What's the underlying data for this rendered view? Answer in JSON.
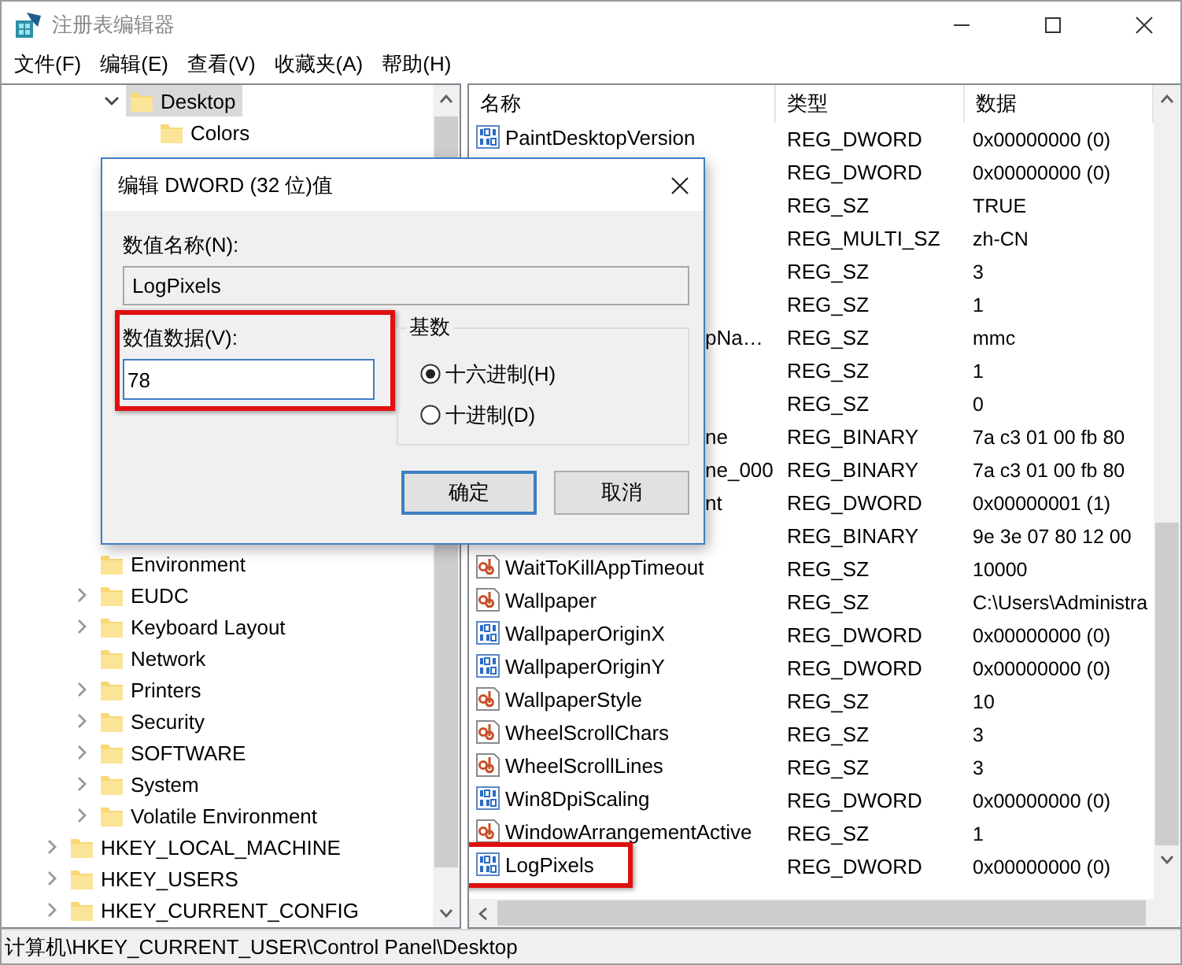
{
  "window": {
    "title": "注册表编辑器"
  },
  "menu": [
    "文件(F)",
    "编辑(E)",
    "查看(V)",
    "收藏夹(A)",
    "帮助(H)"
  ],
  "tree": {
    "items": [
      {
        "children": [
          {
            "children": [
              {
                "label": "Desktop",
                "expandable": true,
                "expanded": true,
                "selected": true,
                "children": [
                  {
                    "label": "Colors",
                    "expandable": false,
                    "selected": false
                  }
                ]
              }
            ]
          },
          {
            "label": "Environment",
            "expandable": false,
            "selected": false
          },
          {
            "label": "EUDC",
            "expandable": true,
            "expanded": false,
            "selected": false
          },
          {
            "label": "Keyboard Layout",
            "expandable": true,
            "expanded": false,
            "selected": false
          },
          {
            "label": "Network",
            "expandable": false,
            "selected": false
          },
          {
            "label": "Printers",
            "expandable": true,
            "expanded": false,
            "selected": false
          },
          {
            "label": "Security",
            "expandable": true,
            "expanded": false,
            "selected": false
          },
          {
            "label": "SOFTWARE",
            "expandable": true,
            "expanded": false,
            "selected": false
          },
          {
            "label": "System",
            "expandable": true,
            "expanded": false,
            "selected": false
          },
          {
            "label": "Volatile Environment",
            "expandable": true,
            "expanded": false,
            "selected": false
          }
        ]
      },
      {
        "label": "HKEY_LOCAL_MACHINE",
        "expandable": true,
        "expanded": false,
        "selected": false
      },
      {
        "label": "HKEY_USERS",
        "expandable": true,
        "expanded": false,
        "selected": false
      },
      {
        "label": "HKEY_CURRENT_CONFIG",
        "expandable": true,
        "expanded": false,
        "selected": false
      }
    ]
  },
  "table": {
    "columns": [
      "名称",
      "类型",
      "数据"
    ],
    "rows": [
      {
        "kind": "dword",
        "name": "PaintDesktopVersion",
        "type": "REG_DWORD",
        "data": "0x00000000 (0)",
        "covered": false,
        "annotated": false
      },
      {
        "type": "REG_DWORD",
        "data": "0x00000000 (0)",
        "annotated": false
      },
      {
        "type": "REG_SZ",
        "data": "TRUE",
        "annotated": false
      },
      {
        "type": "REG_MULTI_SZ",
        "data": "zh-CN",
        "annotated": false
      },
      {
        "type": "REG_SZ",
        "data": "3",
        "annotated": false
      },
      {
        "type": "REG_SZ",
        "data": "1",
        "annotated": false
      },
      {
        "name": "pNa…",
        "type": "REG_SZ",
        "data": "mmc",
        "covered": true,
        "annotated": false
      },
      {
        "type": "REG_SZ",
        "data": "1",
        "annotated": false
      },
      {
        "type": "REG_SZ",
        "data": "0",
        "annotated": false
      },
      {
        "name": "ne",
        "type": "REG_BINARY",
        "data": "7a c3 01 00 fb 80",
        "covered": true,
        "annotated": false
      },
      {
        "name": "ne_000",
        "type": "REG_BINARY",
        "data": "7a c3 01 00 fb 80",
        "covered": true,
        "annotated": false
      },
      {
        "name": "nt",
        "type": "REG_DWORD",
        "data": "0x00000001 (1)",
        "covered": true,
        "annotated": false
      },
      {
        "type": "REG_BINARY",
        "data": "9e 3e 07 80 12 00",
        "annotated": false
      },
      {
        "kind": "string",
        "name": "WaitToKillAppTimeout",
        "type": "REG_SZ",
        "data": "10000",
        "covered": false,
        "annotated": false
      },
      {
        "kind": "string",
        "name": "Wallpaper",
        "type": "REG_SZ",
        "data": "C:\\Users\\Administra",
        "covered": false,
        "annotated": false
      },
      {
        "kind": "dword",
        "name": "WallpaperOriginX",
        "type": "REG_DWORD",
        "data": "0x00000000 (0)",
        "covered": false,
        "annotated": false
      },
      {
        "kind": "dword",
        "name": "WallpaperOriginY",
        "type": "REG_DWORD",
        "data": "0x00000000 (0)",
        "covered": false,
        "annotated": false
      },
      {
        "kind": "string",
        "name": "WallpaperStyle",
        "type": "REG_SZ",
        "data": "10",
        "covered": false,
        "annotated": false
      },
      {
        "kind": "string",
        "name": "WheelScrollChars",
        "type": "REG_SZ",
        "data": "3",
        "covered": false,
        "annotated": false
      },
      {
        "kind": "string",
        "name": "WheelScrollLines",
        "type": "REG_SZ",
        "data": "3",
        "covered": false,
        "annotated": false
      },
      {
        "kind": "dword",
        "name": "Win8DpiScaling",
        "type": "REG_DWORD",
        "data": "0x00000000 (0)",
        "covered": false,
        "annotated": false
      },
      {
        "kind": "string",
        "name": "WindowArrangementActive",
        "type": "REG_SZ",
        "data": "1",
        "covered": false,
        "annotated": false
      },
      {
        "kind": "dword",
        "name": "LogPixels",
        "type": "REG_DWORD",
        "data": "0x00000000 (0)",
        "covered": false,
        "annotated": true
      }
    ]
  },
  "dialog": {
    "title": "编辑 DWORD (32 位)值",
    "name_label": "数值名称(N):",
    "name_value": "LogPixels",
    "value_label": "数值数据(V):",
    "value": "78",
    "value_annotated": true,
    "base_label": "基数",
    "radios": [
      {
        "label": "十六进制(H)",
        "selected": true
      },
      {
        "label": "十进制(D)",
        "selected": false
      }
    ],
    "buttons": [
      {
        "label": "确定",
        "default": true
      },
      {
        "label": "取消",
        "default": false
      }
    ]
  },
  "status_bar": "计算机\\HKEY_CURRENT_USER\\Control Panel\\Desktop"
}
